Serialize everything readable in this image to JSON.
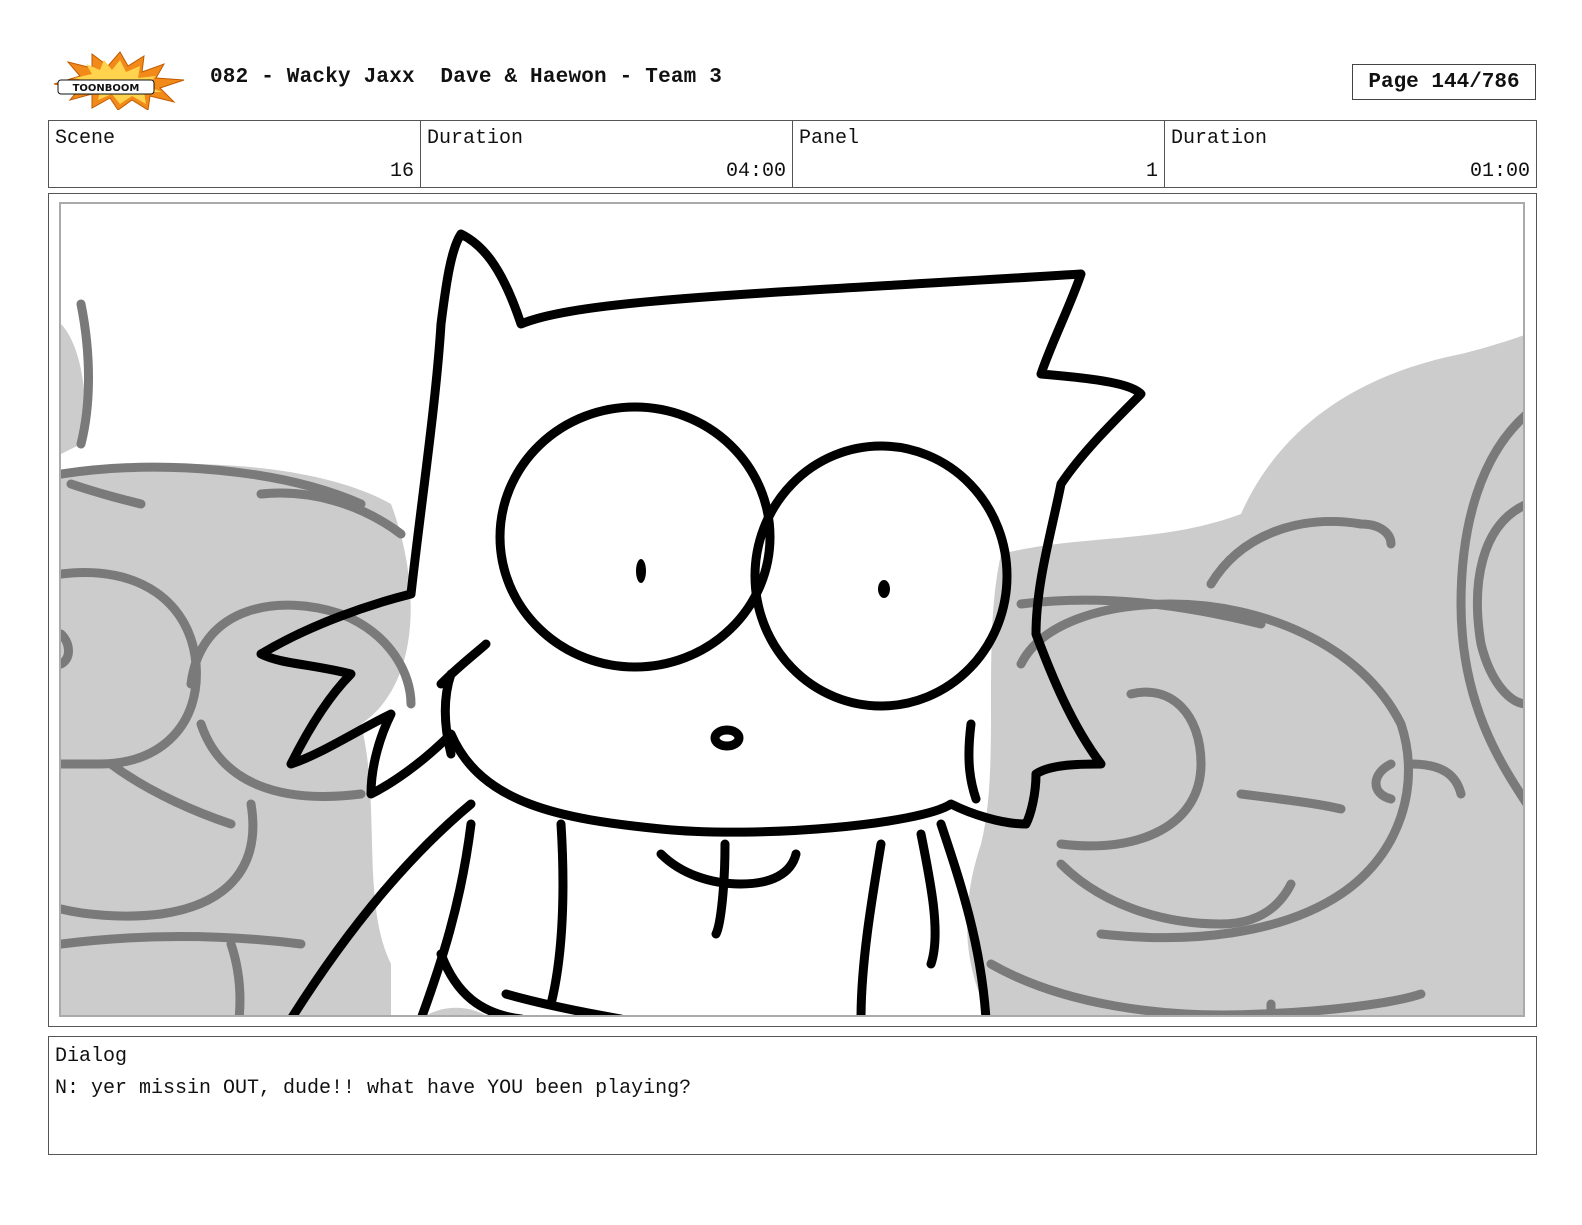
{
  "header": {
    "logo_text": "TOONBOOM",
    "title": "082 - Wacky Jaxx  Dave & Haewon - Team 3",
    "page": "Page 144/786"
  },
  "info": {
    "scene_label": "Scene",
    "scene_value": "16",
    "scene_duration_label": "Duration",
    "scene_duration_value": "04:00",
    "panel_label": "Panel",
    "panel_value": "1",
    "panel_duration_label": "Duration",
    "panel_duration_value": "01:00"
  },
  "panel": {
    "image": "storyboard-sketch-cat-character-wide-eyed-with-grey-crowd"
  },
  "dialog": {
    "label": "Dialog",
    "text": "N: yer missin OUT, dude!! what have YOU been playing?"
  },
  "colors": {
    "logo_burst": "#f28a1a",
    "logo_burst_inner": "#ffd34d",
    "crowd_fill": "#cccccc",
    "crowd_line": "#7a7a7a",
    "ink": "#000000"
  }
}
